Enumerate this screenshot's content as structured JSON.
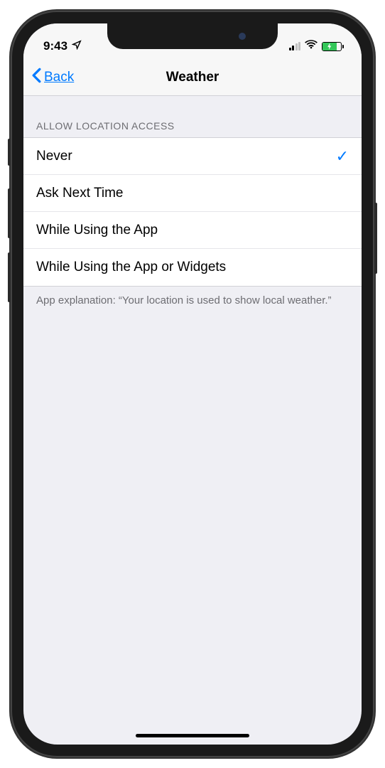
{
  "status_bar": {
    "time": "9:43",
    "location_icon": "location-arrow-icon",
    "signal_icon": "cellular-signal-icon",
    "wifi_icon": "wifi-icon",
    "battery_icon": "battery-charging-icon"
  },
  "nav": {
    "back_label": "Back",
    "title": "Weather"
  },
  "section": {
    "header": "ALLOW LOCATION ACCESS",
    "options": [
      {
        "label": "Never",
        "selected": true
      },
      {
        "label": "Ask Next Time",
        "selected": false
      },
      {
        "label": "While Using the App",
        "selected": false
      },
      {
        "label": "While Using the App or Widgets",
        "selected": false
      }
    ],
    "footer": "App explanation: “Your location is used to show local weather.”"
  }
}
